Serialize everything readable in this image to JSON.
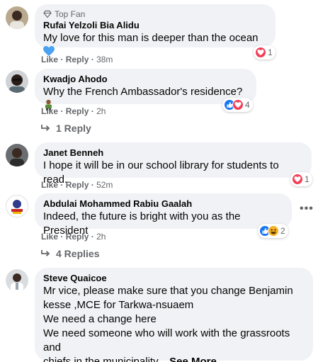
{
  "comments": [
    {
      "badge": "Top Fan",
      "author": "Rufai Yelzoli Bia Alidu",
      "text": "My love for this man is deeper than the ocean",
      "like": "Like",
      "reply": "Reply",
      "time": "38m",
      "reaction_count": "1"
    },
    {
      "author": "Kwadjo Ahodo",
      "text": "Why the French Ambassador's residence?",
      "like": "Like",
      "reply": "Reply",
      "time": "2h",
      "reaction_count": "4",
      "replies_label": "1 Reply"
    },
    {
      "author": "Janet Benneh",
      "text": "I hope it will be in our school library for students to read.",
      "like": "Like",
      "reply": "Reply",
      "time": "52m",
      "reaction_count": "1"
    },
    {
      "author": "Abdulai Mohammed Rabiu Gaalah",
      "text": "Indeed, the future is bright with you as the President",
      "like": "Like",
      "reply": "Reply",
      "time": "2h",
      "reaction_count": "2",
      "replies_label": "4 Replies"
    },
    {
      "author": "Steve Quaicoe",
      "lines": [
        "Mr vice, please make sure that you change Benjamin",
        "kesse ,MCE for Tarkwa-nsuaem",
        "We need a change here",
        "We need someone who will work with the grassroots and"
      ],
      "last_line": "chiefs in the municipality...",
      "see_more": "See More"
    }
  ],
  "separator": "·",
  "colors": {
    "bubble": "#f0f2f5",
    "secondary_text": "#65676b",
    "like_blue": "#1877f2",
    "love_red": "#f33e58",
    "haha_yellow": "#f7b125"
  }
}
